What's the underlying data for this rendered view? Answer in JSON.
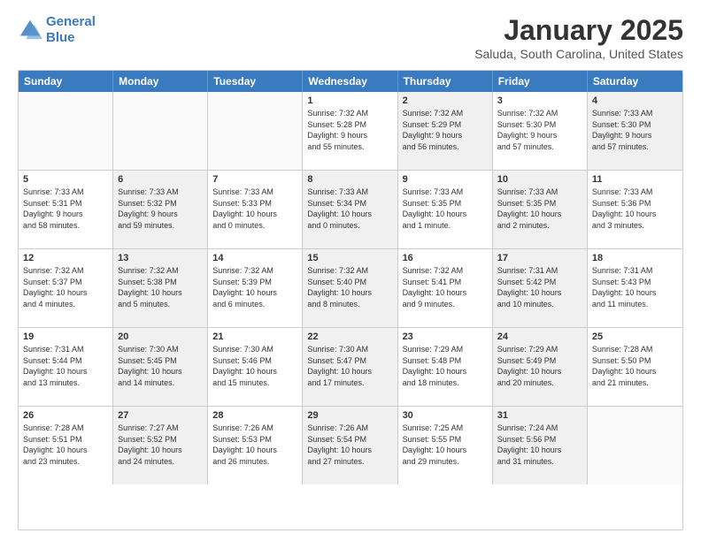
{
  "header": {
    "logo_line1": "General",
    "logo_line2": "Blue",
    "month_year": "January 2025",
    "location": "Saluda, South Carolina, United States"
  },
  "days_of_week": [
    "Sunday",
    "Monday",
    "Tuesday",
    "Wednesday",
    "Thursday",
    "Friday",
    "Saturday"
  ],
  "weeks": [
    {
      "cells": [
        {
          "day": "",
          "empty": true,
          "shaded": false,
          "lines": []
        },
        {
          "day": "",
          "empty": true,
          "shaded": false,
          "lines": []
        },
        {
          "day": "",
          "empty": true,
          "shaded": false,
          "lines": []
        },
        {
          "day": "1",
          "empty": false,
          "shaded": false,
          "lines": [
            "Sunrise: 7:32 AM",
            "Sunset: 5:28 PM",
            "Daylight: 9 hours",
            "and 55 minutes."
          ]
        },
        {
          "day": "2",
          "empty": false,
          "shaded": true,
          "lines": [
            "Sunrise: 7:32 AM",
            "Sunset: 5:29 PM",
            "Daylight: 9 hours",
            "and 56 minutes."
          ]
        },
        {
          "day": "3",
          "empty": false,
          "shaded": false,
          "lines": [
            "Sunrise: 7:32 AM",
            "Sunset: 5:30 PM",
            "Daylight: 9 hours",
            "and 57 minutes."
          ]
        },
        {
          "day": "4",
          "empty": false,
          "shaded": true,
          "lines": [
            "Sunrise: 7:33 AM",
            "Sunset: 5:30 PM",
            "Daylight: 9 hours",
            "and 57 minutes."
          ]
        }
      ]
    },
    {
      "cells": [
        {
          "day": "5",
          "empty": false,
          "shaded": false,
          "lines": [
            "Sunrise: 7:33 AM",
            "Sunset: 5:31 PM",
            "Daylight: 9 hours",
            "and 58 minutes."
          ]
        },
        {
          "day": "6",
          "empty": false,
          "shaded": true,
          "lines": [
            "Sunrise: 7:33 AM",
            "Sunset: 5:32 PM",
            "Daylight: 9 hours",
            "and 59 minutes."
          ]
        },
        {
          "day": "7",
          "empty": false,
          "shaded": false,
          "lines": [
            "Sunrise: 7:33 AM",
            "Sunset: 5:33 PM",
            "Daylight: 10 hours",
            "and 0 minutes."
          ]
        },
        {
          "day": "8",
          "empty": false,
          "shaded": true,
          "lines": [
            "Sunrise: 7:33 AM",
            "Sunset: 5:34 PM",
            "Daylight: 10 hours",
            "and 0 minutes."
          ]
        },
        {
          "day": "9",
          "empty": false,
          "shaded": false,
          "lines": [
            "Sunrise: 7:33 AM",
            "Sunset: 5:35 PM",
            "Daylight: 10 hours",
            "and 1 minute."
          ]
        },
        {
          "day": "10",
          "empty": false,
          "shaded": true,
          "lines": [
            "Sunrise: 7:33 AM",
            "Sunset: 5:35 PM",
            "Daylight: 10 hours",
            "and 2 minutes."
          ]
        },
        {
          "day": "11",
          "empty": false,
          "shaded": false,
          "lines": [
            "Sunrise: 7:33 AM",
            "Sunset: 5:36 PM",
            "Daylight: 10 hours",
            "and 3 minutes."
          ]
        }
      ]
    },
    {
      "cells": [
        {
          "day": "12",
          "empty": false,
          "shaded": false,
          "lines": [
            "Sunrise: 7:32 AM",
            "Sunset: 5:37 PM",
            "Daylight: 10 hours",
            "and 4 minutes."
          ]
        },
        {
          "day": "13",
          "empty": false,
          "shaded": true,
          "lines": [
            "Sunrise: 7:32 AM",
            "Sunset: 5:38 PM",
            "Daylight: 10 hours",
            "and 5 minutes."
          ]
        },
        {
          "day": "14",
          "empty": false,
          "shaded": false,
          "lines": [
            "Sunrise: 7:32 AM",
            "Sunset: 5:39 PM",
            "Daylight: 10 hours",
            "and 6 minutes."
          ]
        },
        {
          "day": "15",
          "empty": false,
          "shaded": true,
          "lines": [
            "Sunrise: 7:32 AM",
            "Sunset: 5:40 PM",
            "Daylight: 10 hours",
            "and 8 minutes."
          ]
        },
        {
          "day": "16",
          "empty": false,
          "shaded": false,
          "lines": [
            "Sunrise: 7:32 AM",
            "Sunset: 5:41 PM",
            "Daylight: 10 hours",
            "and 9 minutes."
          ]
        },
        {
          "day": "17",
          "empty": false,
          "shaded": true,
          "lines": [
            "Sunrise: 7:31 AM",
            "Sunset: 5:42 PM",
            "Daylight: 10 hours",
            "and 10 minutes."
          ]
        },
        {
          "day": "18",
          "empty": false,
          "shaded": false,
          "lines": [
            "Sunrise: 7:31 AM",
            "Sunset: 5:43 PM",
            "Daylight: 10 hours",
            "and 11 minutes."
          ]
        }
      ]
    },
    {
      "cells": [
        {
          "day": "19",
          "empty": false,
          "shaded": false,
          "lines": [
            "Sunrise: 7:31 AM",
            "Sunset: 5:44 PM",
            "Daylight: 10 hours",
            "and 13 minutes."
          ]
        },
        {
          "day": "20",
          "empty": false,
          "shaded": true,
          "lines": [
            "Sunrise: 7:30 AM",
            "Sunset: 5:45 PM",
            "Daylight: 10 hours",
            "and 14 minutes."
          ]
        },
        {
          "day": "21",
          "empty": false,
          "shaded": false,
          "lines": [
            "Sunrise: 7:30 AM",
            "Sunset: 5:46 PM",
            "Daylight: 10 hours",
            "and 15 minutes."
          ]
        },
        {
          "day": "22",
          "empty": false,
          "shaded": true,
          "lines": [
            "Sunrise: 7:30 AM",
            "Sunset: 5:47 PM",
            "Daylight: 10 hours",
            "and 17 minutes."
          ]
        },
        {
          "day": "23",
          "empty": false,
          "shaded": false,
          "lines": [
            "Sunrise: 7:29 AM",
            "Sunset: 5:48 PM",
            "Daylight: 10 hours",
            "and 18 minutes."
          ]
        },
        {
          "day": "24",
          "empty": false,
          "shaded": true,
          "lines": [
            "Sunrise: 7:29 AM",
            "Sunset: 5:49 PM",
            "Daylight: 10 hours",
            "and 20 minutes."
          ]
        },
        {
          "day": "25",
          "empty": false,
          "shaded": false,
          "lines": [
            "Sunrise: 7:28 AM",
            "Sunset: 5:50 PM",
            "Daylight: 10 hours",
            "and 21 minutes."
          ]
        }
      ]
    },
    {
      "cells": [
        {
          "day": "26",
          "empty": false,
          "shaded": false,
          "lines": [
            "Sunrise: 7:28 AM",
            "Sunset: 5:51 PM",
            "Daylight: 10 hours",
            "and 23 minutes."
          ]
        },
        {
          "day": "27",
          "empty": false,
          "shaded": true,
          "lines": [
            "Sunrise: 7:27 AM",
            "Sunset: 5:52 PM",
            "Daylight: 10 hours",
            "and 24 minutes."
          ]
        },
        {
          "day": "28",
          "empty": false,
          "shaded": false,
          "lines": [
            "Sunrise: 7:26 AM",
            "Sunset: 5:53 PM",
            "Daylight: 10 hours",
            "and 26 minutes."
          ]
        },
        {
          "day": "29",
          "empty": false,
          "shaded": true,
          "lines": [
            "Sunrise: 7:26 AM",
            "Sunset: 5:54 PM",
            "Daylight: 10 hours",
            "and 27 minutes."
          ]
        },
        {
          "day": "30",
          "empty": false,
          "shaded": false,
          "lines": [
            "Sunrise: 7:25 AM",
            "Sunset: 5:55 PM",
            "Daylight: 10 hours",
            "and 29 minutes."
          ]
        },
        {
          "day": "31",
          "empty": false,
          "shaded": true,
          "lines": [
            "Sunrise: 7:24 AM",
            "Sunset: 5:56 PM",
            "Daylight: 10 hours",
            "and 31 minutes."
          ]
        },
        {
          "day": "",
          "empty": true,
          "shaded": false,
          "lines": []
        }
      ]
    }
  ]
}
